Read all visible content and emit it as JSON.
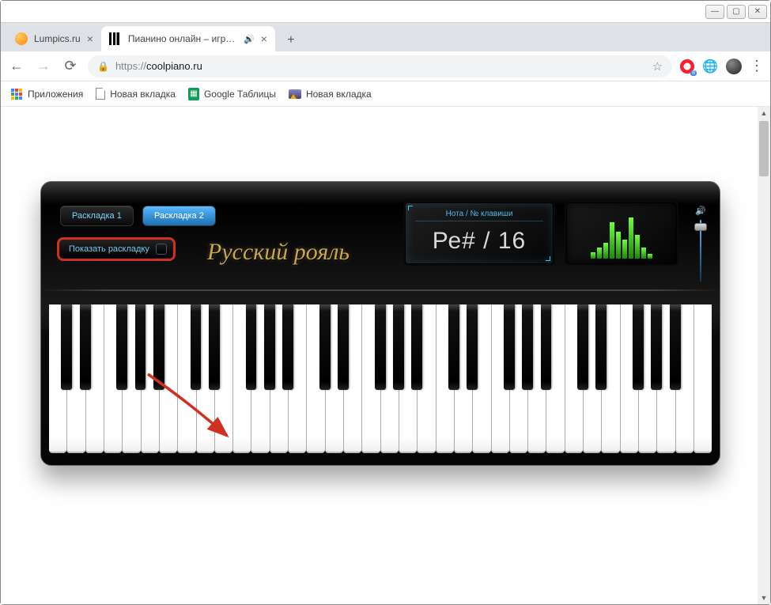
{
  "window": {
    "tabs": [
      {
        "title": "Lumpics.ru",
        "active": false
      },
      {
        "title": "Пианино онлайн – играть н",
        "active": true,
        "audio": true
      }
    ]
  },
  "address": {
    "scheme": "https://",
    "host": "coolpiano.ru"
  },
  "bookmarks": {
    "apps": "Приложения",
    "newtab1": "Новая вкладка",
    "sheets": "Google Таблицы",
    "newtab2": "Новая вкладка"
  },
  "piano": {
    "layout1": "Раскладка 1",
    "layout2": "Раскладка 2",
    "show_layout": "Показать раскладку",
    "logo": "Русский рояль",
    "lcd_caption": "Нота / № клавиши",
    "lcd_value": "Ре# / 16",
    "eq_bars": [
      8,
      14,
      20,
      46,
      34,
      24,
      52,
      30,
      14,
      6
    ],
    "white_keys": 36,
    "black_pattern": [
      true,
      true,
      false,
      true,
      true,
      true,
      false
    ]
  },
  "ext": {
    "opera_badge": "8"
  }
}
